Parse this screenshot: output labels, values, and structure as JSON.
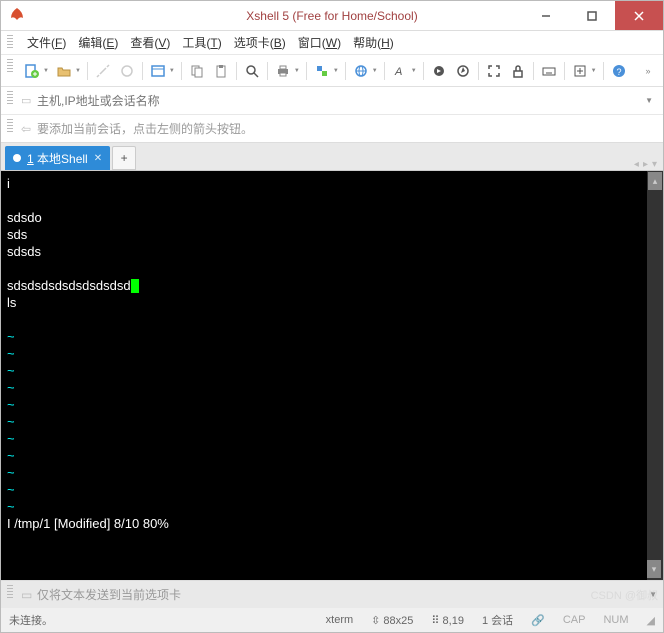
{
  "window": {
    "title": "Xshell 5 (Free for Home/School)"
  },
  "menus": [
    {
      "label": "文件",
      "key": "F"
    },
    {
      "label": "编辑",
      "key": "E"
    },
    {
      "label": "查看",
      "key": "V"
    },
    {
      "label": "工具",
      "key": "T"
    },
    {
      "label": "选项卡",
      "key": "B"
    },
    {
      "label": "窗口",
      "key": "W"
    },
    {
      "label": "帮助",
      "key": "H"
    }
  ],
  "addressbar": {
    "placeholder": "主机,IP地址或会话名称"
  },
  "hintbar": {
    "text": "要添加当前会话，点击左侧的箭头按钮。"
  },
  "tabs": {
    "active": {
      "label": "1 本地Shell"
    },
    "add": "+"
  },
  "terminal": {
    "lines": [
      "i",
      "",
      "sdsdo",
      "sds",
      "sdsds",
      ""
    ],
    "cursor_line_prefix": "sdsdsdsdsdsdsdsdsd",
    "after_cursor_lines": [
      "ls",
      ""
    ],
    "tilde_rows": 11,
    "status_line": "I /tmp/1 [Modified] 8/10 80%"
  },
  "sendbar": {
    "text": "仅将文本发送到当前选项卡"
  },
  "statusbar": {
    "conn": "未连接。",
    "term": "xterm",
    "size_icon": "⇳",
    "size": "88x25",
    "pos_icon": "⠿",
    "pos": "8,19",
    "sessions": "1 会话",
    "caps": "CAP",
    "num": "NUM"
  },
  "watermark": "CSDN @御叔"
}
